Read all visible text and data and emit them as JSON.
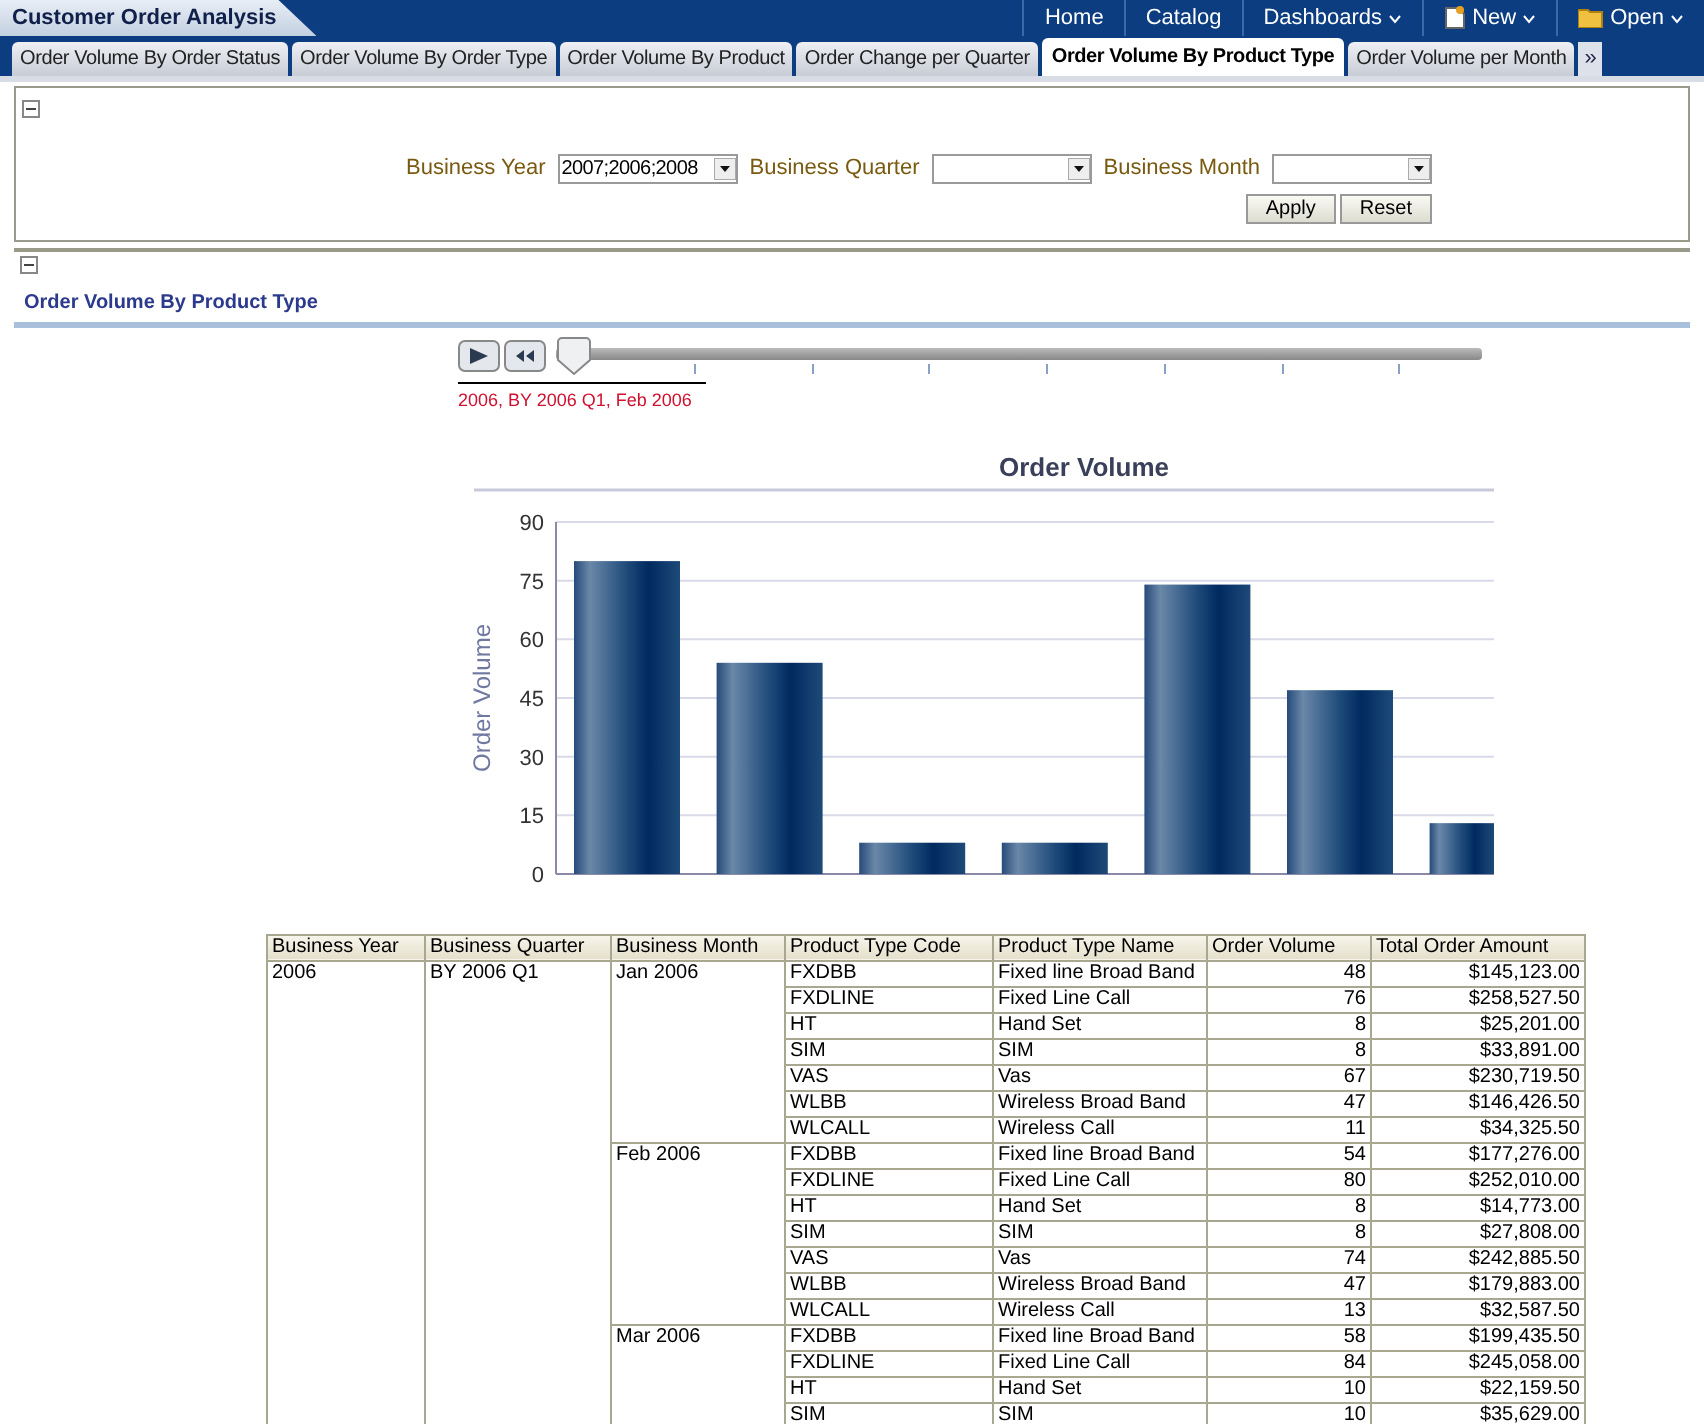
{
  "app_title": "Customer Order Analysis",
  "nav": [
    {
      "label": "Home",
      "kind": "link"
    },
    {
      "label": "Catalog",
      "kind": "link"
    },
    {
      "label": "Dashboards",
      "kind": "menu"
    },
    {
      "label": "New",
      "kind": "new"
    },
    {
      "label": "Open",
      "kind": "open"
    }
  ],
  "tabs": [
    {
      "label": "Order Volume By Order Status",
      "selected": false
    },
    {
      "label": "Order Volume By Order Type",
      "selected": false
    },
    {
      "label": "Order Volume By Product",
      "selected": false
    },
    {
      "label": "Order Change per Quarter",
      "selected": false
    },
    {
      "label": "Order Volume By Product Type",
      "selected": true
    },
    {
      "label": "Order Volume per Month",
      "selected": false
    }
  ],
  "tabs_more": "»",
  "filters": [
    {
      "label": "Business Year",
      "value": "2007;2006;2008"
    },
    {
      "label": "Business Quarter"
    },
    {
      "label": "Business Month"
    }
  ],
  "buttons": [
    "Apply",
    "Reset"
  ],
  "section_title": "Order Volume By Product Type",
  "slider": {
    "level": 0,
    "caption": "2006, BY 2006 Q1, Feb 2006"
  },
  "chart_data": {
    "type": "bar",
    "title": "Order Volume",
    "ylabel": "Order Volume",
    "values": [
      80,
      54,
      8,
      8,
      74,
      47,
      13
    ],
    "ylim": [
      0,
      90
    ],
    "grid": true,
    "yticks": [
      0,
      15,
      30,
      45,
      60,
      75,
      90
    ]
  },
  "table": {
    "columns": [
      "Business Year",
      "Business Quarter",
      "Business Month",
      "Product Type Code",
      "Product Type Name",
      "Order Volume",
      "Total Order Amount"
    ],
    "groups": [
      {
        "year": "2006",
        "quarter": "BY 2006 Q1",
        "months": [
          {
            "month": "Jan 2006",
            "rows": [
              [
                "FXDBB",
                "Fixed line Broad Band",
                "48",
                "$145,123.00"
              ],
              [
                "FXDLINE",
                "Fixed Line Call",
                "76",
                "$258,527.50"
              ],
              [
                "HT",
                "Hand Set",
                "8",
                "$25,201.00"
              ],
              [
                "SIM",
                "SIM",
                "8",
                "$33,891.00"
              ],
              [
                "VAS",
                "Vas",
                "67",
                "$230,719.50"
              ],
              [
                "WLBB",
                "Wireless Broad Band",
                "47",
                "$146,426.50"
              ],
              [
                "WLCALL",
                "Wireless Call",
                "11",
                "$34,325.50"
              ]
            ]
          },
          {
            "month": "Feb 2006",
            "rows": [
              [
                "FXDBB",
                "Fixed line Broad Band",
                "54",
                "$177,276.00"
              ],
              [
                "FXDLINE",
                "Fixed Line Call",
                "80",
                "$252,010.00"
              ],
              [
                "HT",
                "Hand Set",
                "8",
                "$14,773.00"
              ],
              [
                "SIM",
                "SIM",
                "8",
                "$27,808.00"
              ],
              [
                "VAS",
                "Vas",
                "74",
                "$242,885.50"
              ],
              [
                "WLBB",
                "Wireless Broad Band",
                "47",
                "$179,883.00"
              ],
              [
                "WLCALL",
                "Wireless Call",
                "13",
                "$32,587.50"
              ]
            ]
          },
          {
            "month": "Mar 2006",
            "rows": [
              [
                "FXDBB",
                "Fixed line Broad Band",
                "58",
                "$199,435.50"
              ],
              [
                "FXDLINE",
                "Fixed Line Call",
                "84",
                "$245,058.00"
              ],
              [
                "HT",
                "Hand Set",
                "10",
                "$22,159.50"
              ],
              [
                "SIM",
                "SIM",
                "10",
                "$35,629.00"
              ]
            ]
          }
        ]
      }
    ]
  }
}
